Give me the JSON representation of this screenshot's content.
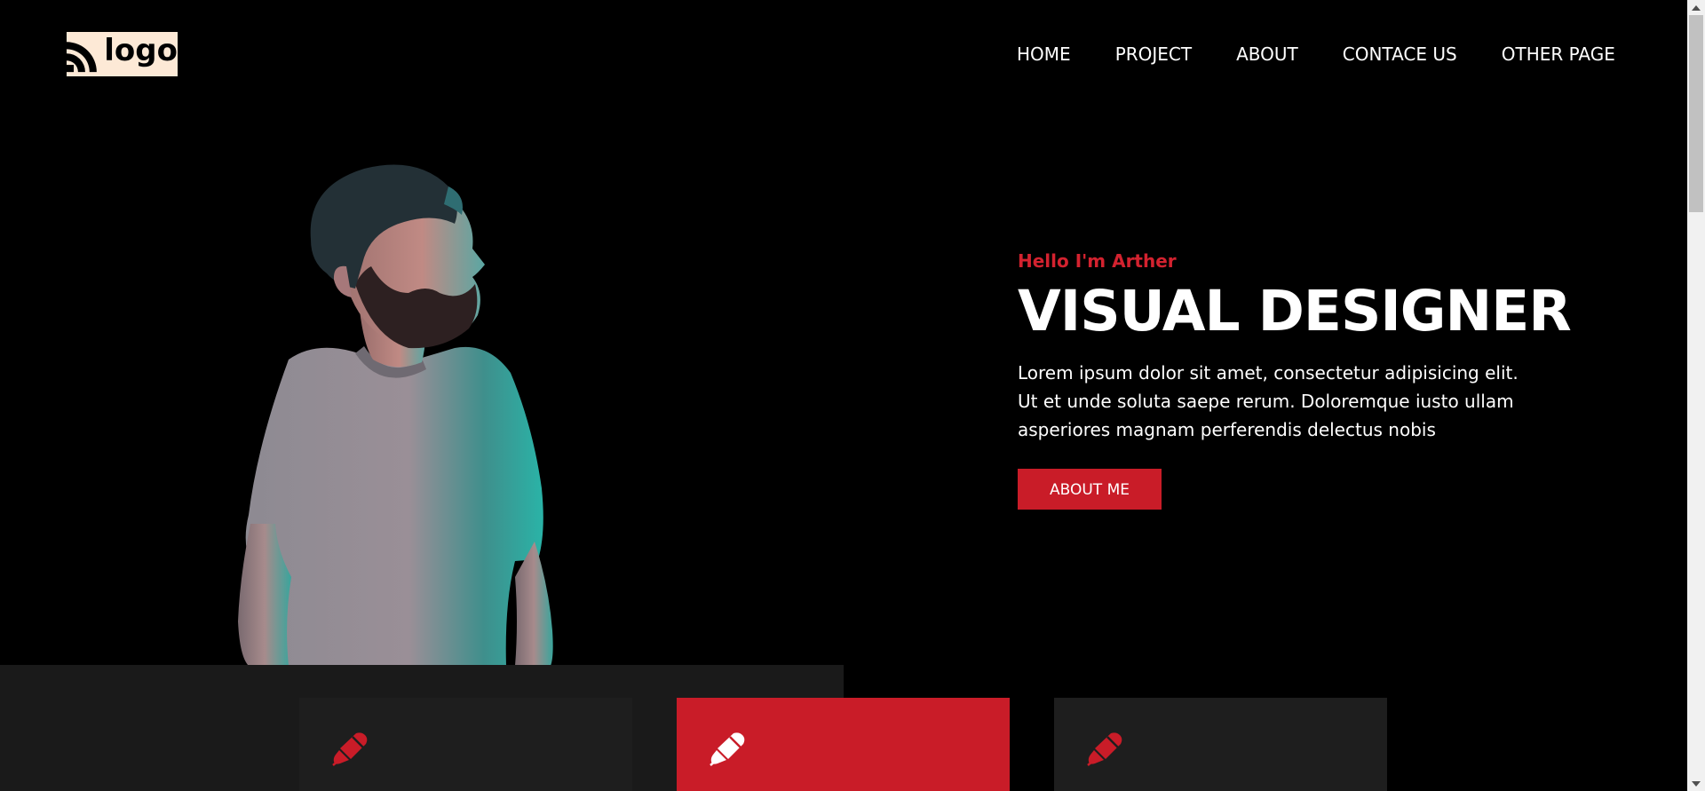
{
  "header": {
    "logo_text": "logo",
    "nav": [
      "HOME",
      "PROJECT",
      "ABOUT",
      "CONTACE US",
      "OTHER PAGE"
    ]
  },
  "hero": {
    "greeting": "Hello I'm Arther",
    "title": "VISUAL DESIGNER",
    "description": "Lorem ipsum dolor sit amet, consectetur adipisicing elit. Ut et unde soluta saepe rerum. Doloremque iusto ullam asperiores magnam perferendis delectus nobis",
    "cta_label": "ABOUT ME"
  },
  "services": {
    "cards": [
      {
        "icon": "pen-icon",
        "active": false
      },
      {
        "icon": "pen-icon",
        "active": true
      },
      {
        "icon": "pen-icon",
        "active": false
      }
    ]
  },
  "colors": {
    "background": "#000000",
    "accent": "#c91c28",
    "logo_bg": "#fde9d6",
    "card_bg": "#1e1e1e"
  }
}
